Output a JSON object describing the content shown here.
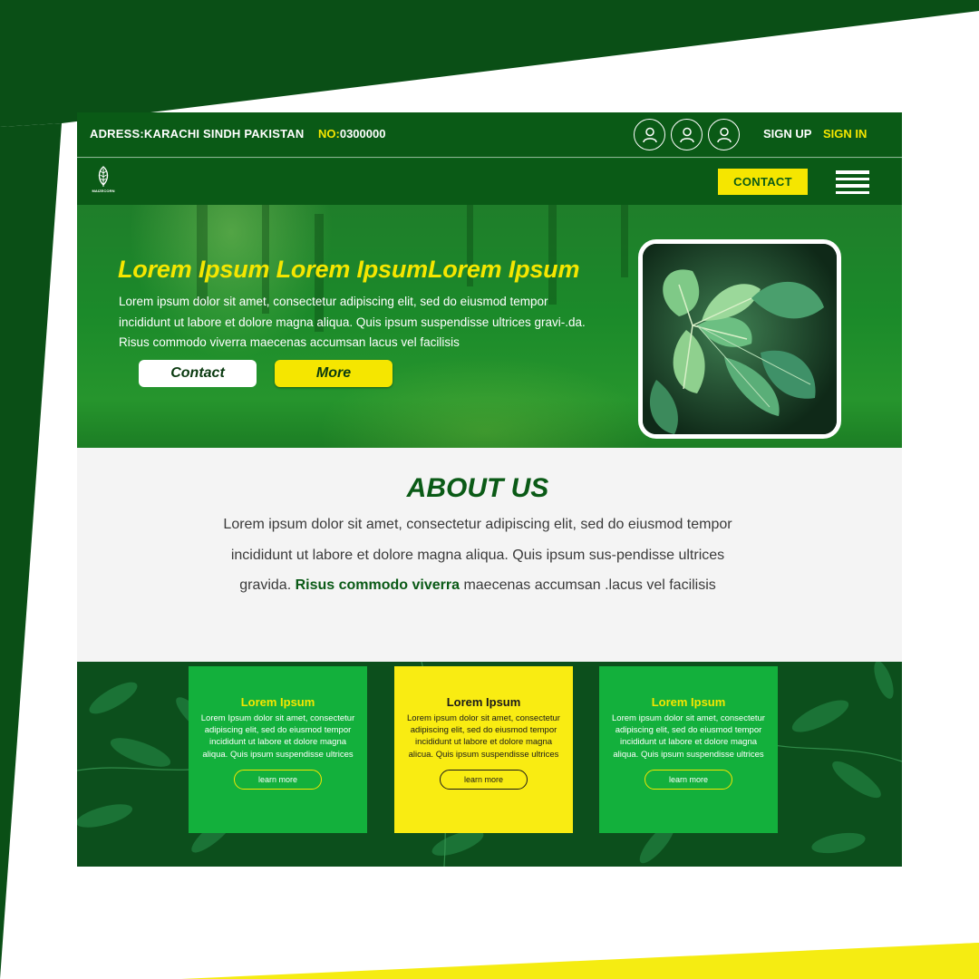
{
  "colors": {
    "dark_green": "#0a5a16",
    "green": "#13b03c",
    "yellow": "#f5e600",
    "white": "#ffffff"
  },
  "topbar": {
    "address": "ADRESS:KARACHI SINDH PAKISTAN",
    "phone_label": "NO:",
    "phone_number": "0300000",
    "avatar_icons": [
      "user-icon",
      "user-icon",
      "user-icon"
    ],
    "sign_up": "SIGN UP",
    "sign_in": "SIGN IN"
  },
  "navbar": {
    "logo_text": "MAIZECORN",
    "contact_label": "CONTACT",
    "menu_icon": "hamburger-menu-icon"
  },
  "hero": {
    "title": "Lorem Ipsum Lorem IpsumLorem Ipsum",
    "text": "Lorem ipsum dolor sit amet, consectetur adipiscing elit, sed do eiusmod tempor incididunt ut labore et dolore magna aliqua. Quis ipsum suspendisse ultrices gravi-.da. Risus commodo viverra maecenas accumsan lacus vel facilisis",
    "contact_label": "Contact",
    "more_label": "More"
  },
  "about": {
    "title": "ABOUT US",
    "text_before": "Lorem ipsum dolor sit amet, consectetur adipiscing elit, sed do eiusmod tempor incididunt ut labore et dolore magna aliqua. Quis ipsum sus-pendisse ultrices gravida. ",
    "text_highlight": "Risus commodo viverra",
    "text_after": " maecenas accumsan .lacus vel facilisis"
  },
  "cards": [
    {
      "title": "Lorem Ipsum",
      "text": "Lorem Ipsum dolor sit amet, consectetur adipiscing elit, sed do eiusmod tempor incididunt ut labore et dolore magna aliqua. Quis ipsum suspendisse ultrices",
      "button": "learn more"
    },
    {
      "title": "Lorem Ipsum",
      "text": "Lorem ipsum dolor sit amet, consectetur adipiscing elit, sed do eiusmod tempor incididunt ut labore et dolore magna alicua. Quis ipsum suspendisse ultrices",
      "button": "learn more"
    },
    {
      "title": "Lorem Ipsum",
      "text": "Lorem ipsum dolor sit amet, consectetur adipiscing elit, sed do eiusmod tempor incididunt ut labore et dolore magna aliqua. Quis ipsum suspendisse ultrices",
      "button": "learn more"
    }
  ]
}
